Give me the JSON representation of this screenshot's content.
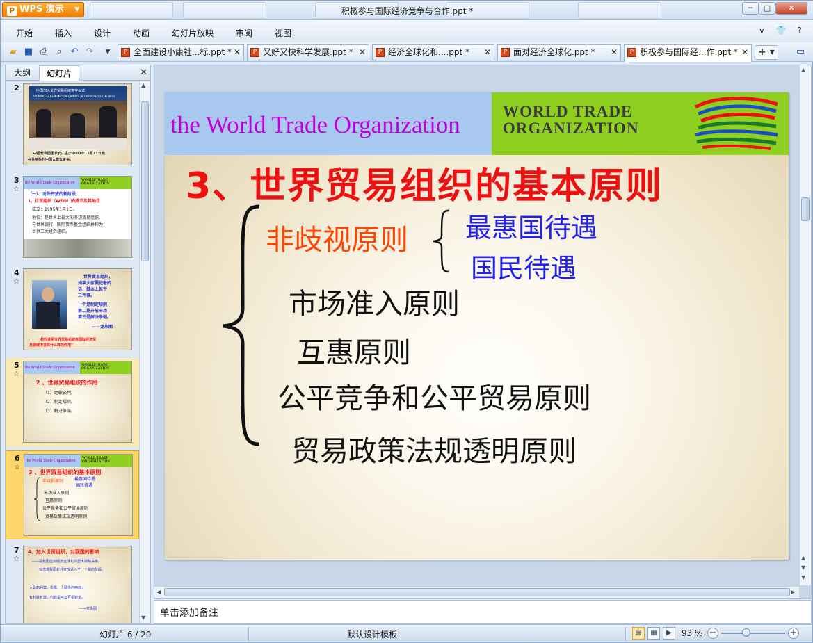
{
  "window": {
    "title": "积极参与国际经济竞争与合作.ppt *",
    "app_button": "WPS 演示",
    "minimize": "─",
    "maximize": "□",
    "close": "✕"
  },
  "menu": {
    "items": [
      "开始",
      "插入",
      "设计",
      "动画",
      "幻灯片放映",
      "审阅",
      "视图"
    ],
    "right": "∨ 👕 ?"
  },
  "toolbar": {
    "icons": [
      "open-icon",
      "save-icon",
      "print-icon",
      "print-preview-icon",
      "undo-icon",
      "redo-icon",
      "customize-icon"
    ]
  },
  "doc_tabs": [
    {
      "label": "全面建设小康社...标.ppt *"
    },
    {
      "label": "又好又快科学发展.ppt *"
    },
    {
      "label": "经济全球化和....ppt *"
    },
    {
      "label": "面对经济全球化.ppt *"
    },
    {
      "label": "积极参与国际经...作.ppt *"
    }
  ],
  "tab_add": "+ ▾",
  "left_panel": {
    "tabs": [
      "大纲",
      "幻灯片"
    ],
    "active_tab": "幻灯片",
    "close": "✕",
    "thumbnails": [
      {
        "num": "2",
        "star": "",
        "lines": [
          "中国加入世界贸易组织签字仪式",
          "SIGNING CEREMONY ON CHINA'S ACCESSION TO THE WTO",
          "中国代表团团长石广生于2001年12月11日晚",
          "在多哈签约中国入世议定书。"
        ]
      },
      {
        "num": "3",
        "star": "☆",
        "banner": "the World Trade Organization",
        "lines": [
          "（一）、对外开放的新阶段",
          "1、世贸组织（WTO）的成立及其地位",
          "成立：1995年1月1日。",
          "地位：是世界上最大的多边贸易组织。",
          "与世界银行、国际货币基金组织并称为",
          "世界三大经济组织。"
        ]
      },
      {
        "num": "4",
        "star": "☆",
        "lines": [
          "世界贸易组织，",
          "如果大家要记着的",
          "话，基本上就干",
          "三件事。",
          "一个是制定规则，",
          "第二是开放市场，",
          "第三是解决争端。",
          "——龙永图",
          "材料说明世界贸易组织在国际经济贸",
          "易领域中发挥什么样的作用？"
        ]
      },
      {
        "num": "5",
        "star": "☆",
        "banner": "the World Trade Organization",
        "lines": [
          "2 、世界贸易组织的作用",
          "（1）组织谈判。",
          "（2）制定规则。",
          "（3）解决争端。"
        ]
      },
      {
        "num": "6",
        "star": "☆",
        "banner": "the World Trade Organization",
        "lines": [
          "3 、世界贸易组织的基本原则",
          "非歧视原则",
          "最惠国待遇",
          "国民待遇",
          "市场准入原则",
          "互惠原则",
          "公平竞争和公平贸易原则",
          "贸易政策法规透明原则"
        ]
      },
      {
        "num": "7",
        "star": "☆",
        "lines": [
          "4、加入世贸组织，对我国的影响",
          "——是我国应对经济全球化的重大战略决策。",
          "标志着我国对外开放进入了一个新的阶段。",
          "入世的利弊，犹像一个硬币的两面，",
          "有利就有弊，利弊是可以互相转变。",
          "——龙永图"
        ]
      }
    ]
  },
  "slide": {
    "banner_title": "the World Trade Organization",
    "wto_logo_line1": "WORLD TRADE",
    "wto_logo_line2": "ORGANIZATION",
    "heading": "3、世界贸易组织的基本原则",
    "principles": {
      "p1": "非歧视原则",
      "p1a": "最惠国待遇",
      "p1b": "国民待遇",
      "p2": "市场准入原则",
      "p3": "互惠原则",
      "p4": "公平竞争和公平贸易原则",
      "p5": "贸易政策法规透明原则"
    }
  },
  "notes": {
    "placeholder": "单击添加备注"
  },
  "status": {
    "slide_counter": "幻灯片 6 / 20",
    "template": "默认设计模板",
    "zoom": "93 %",
    "zoom_level": 0.39
  },
  "colors": {
    "heading": "#ee1111",
    "non_discrimination": "#ff4400",
    "sub_items": "#2222ee",
    "banner": "#a8c8f0",
    "wto_green": "#8fcf1f",
    "banner_title": "#c000d8"
  }
}
